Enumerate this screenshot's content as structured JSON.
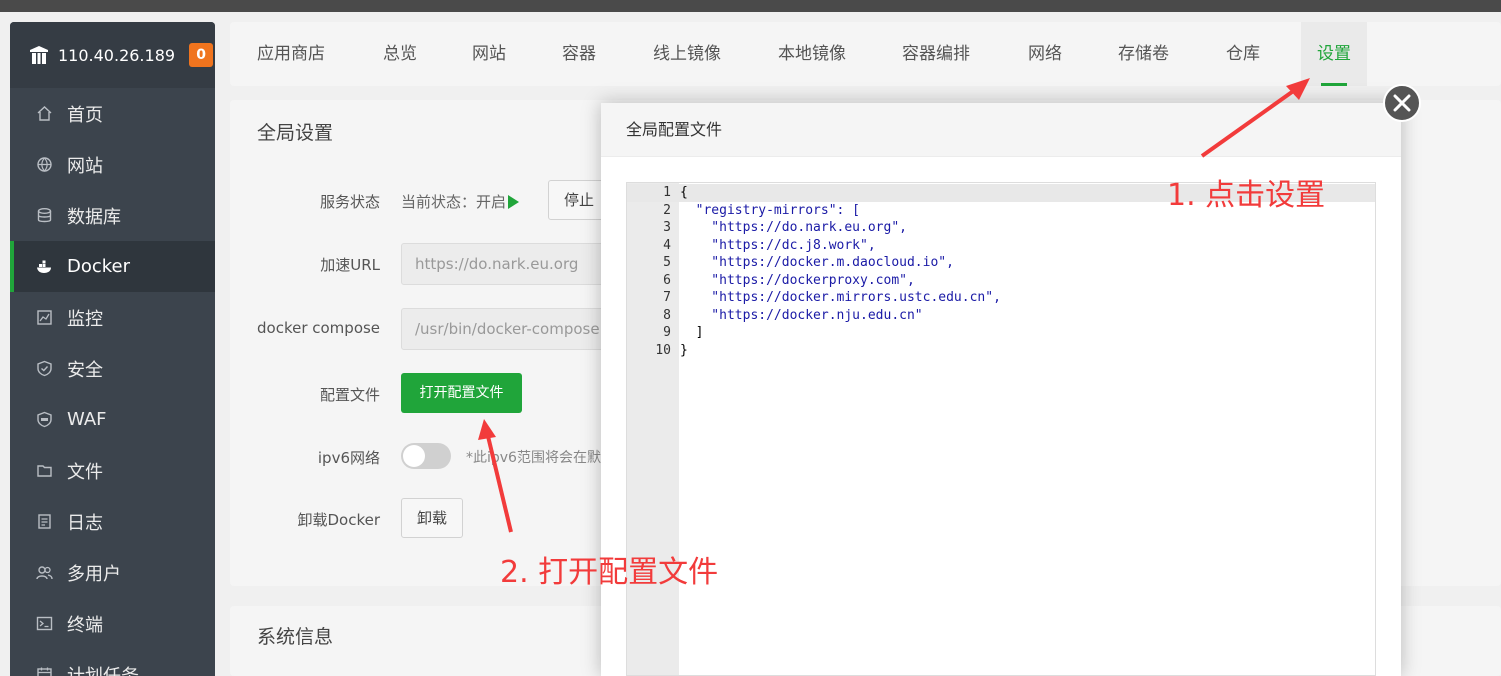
{
  "sidebar": {
    "ip": "110.40.26.189",
    "badge": "0",
    "items": [
      {
        "label": "首页",
        "icon": "home-icon"
      },
      {
        "label": "网站",
        "icon": "globe-icon"
      },
      {
        "label": "数据库",
        "icon": "database-icon"
      },
      {
        "label": "Docker",
        "icon": "docker-icon",
        "active": true
      },
      {
        "label": "监控",
        "icon": "monitor-icon"
      },
      {
        "label": "安全",
        "icon": "shield-icon"
      },
      {
        "label": "WAF",
        "icon": "waf-icon"
      },
      {
        "label": "文件",
        "icon": "folder-icon"
      },
      {
        "label": "日志",
        "icon": "log-icon"
      },
      {
        "label": "多用户",
        "icon": "users-icon"
      },
      {
        "label": "终端",
        "icon": "terminal-icon"
      },
      {
        "label": "计划任务",
        "icon": "task-icon"
      }
    ]
  },
  "tabs": [
    "应用商店",
    "总览",
    "网站",
    "容器",
    "线上镜像",
    "本地镜像",
    "容器编排",
    "网络",
    "存储卷",
    "仓库",
    "设置"
  ],
  "active_tab": "设置",
  "settings": {
    "title": "全局设置",
    "service_status_label": "服务状态",
    "current_status": "当前状态：开启",
    "stop_button": "停止",
    "mirror_url_label": "加速URL",
    "mirror_url_value": "https://do.nark.eu.org",
    "compose_label": "docker compose",
    "compose_value": "/usr/bin/docker-compose",
    "config_file_label": "配置文件",
    "open_config_button": "打开配置文件",
    "ipv6_label": "ipv6网络",
    "ipv6_hint": "*此ipv6范围将会在默",
    "uninstall_label": "卸载Docker",
    "uninstall_button": "卸载"
  },
  "system_info_title": "系统信息",
  "modal": {
    "title": "全局配置文件",
    "lines": [
      {
        "n": "1",
        "text": "{"
      },
      {
        "n": "2",
        "text": "  \"registry-mirrors\": ["
      },
      {
        "n": "3",
        "text": "    \"https://do.nark.eu.org\","
      },
      {
        "n": "4",
        "text": "    \"https://dc.j8.work\","
      },
      {
        "n": "5",
        "text": "    \"https://docker.m.daocloud.io\","
      },
      {
        "n": "6",
        "text": "    \"https://dockerproxy.com\","
      },
      {
        "n": "7",
        "text": "    \"https://docker.mirrors.ustc.edu.cn\","
      },
      {
        "n": "8",
        "text": "    \"https://docker.nju.edu.cn\""
      },
      {
        "n": "9",
        "text": "  ]"
      },
      {
        "n": "10",
        "text": "}"
      }
    ]
  },
  "annotations": {
    "step1": "1. 点击设置",
    "step2": "2. 打开配置文件"
  },
  "colors": {
    "accent": "#20a53a",
    "annotation": "#f23b3b",
    "badge": "#f0741e",
    "sidebar": "#3c444d"
  }
}
